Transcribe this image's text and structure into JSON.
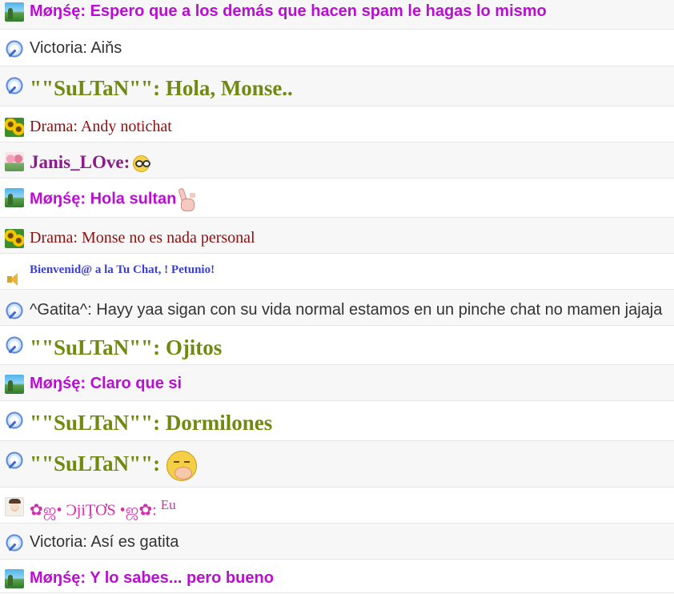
{
  "messages": [
    {
      "name": "Møŋśę",
      "text": "Espero que a los demás que hacen spam le hagas lo mismo",
      "avatar": "landscape-avatar-icon",
      "style": "sans-bold-purple",
      "height": 37,
      "pad_top": 3
    },
    {
      "name": "Victoria",
      "text": "Aiňs",
      "avatar": "feather-avatar-icon",
      "style": "sans-gray",
      "height": 46,
      "pad_top": 12
    },
    {
      "name": "\"\"SuLTaN\"\"",
      "text": "Hola, Monse..",
      "avatar": "feather-avatar-icon",
      "style": "serif-olive",
      "height": 50,
      "pad_top": 12
    },
    {
      "name": "Drama",
      "text": "Andy notichat",
      "avatar": "sunflower-avatar-icon",
      "style": "serif-red",
      "height": 45,
      "pad_top": 14
    },
    {
      "name": "Janis_LOve",
      "text": "",
      "avatar": "tulip-avatar-icon",
      "style": "serif-bold-purple",
      "height": 45,
      "pad_top": 12,
      "emoji": "nerd-emoji-icon"
    },
    {
      "name": "Møŋśę",
      "text": "Hola sultan",
      "avatar": "landscape-avatar-icon",
      "style": "sans-bold-purple",
      "height": 49,
      "pad_top": 12,
      "emoji": "peace-hand-emoji-icon"
    },
    {
      "name": "Drama",
      "text": "Monse no es nada personal",
      "avatar": "sunflower-avatar-icon",
      "style": "serif-red",
      "height": 45,
      "pad_top": 14
    },
    {
      "name": "",
      "text": "Bienvenid@ a la Tu Chat, ! Petunio!",
      "avatar": "speaker-icon",
      "style": "system",
      "height": 45,
      "pad_top": 12
    },
    {
      "name": "^Gatita^",
      "text": "Hayy yaa sigan con su vida normal estamos en un pinche chat no mamen jajaja",
      "avatar": "feather-avatar-icon",
      "style": "sans-gray",
      "height": 45,
      "pad_top": 14
    },
    {
      "name": "\"\"SuLTaN\"\"",
      "text": "Ojitos",
      "avatar": "feather-avatar-icon",
      "style": "serif-olive",
      "height": 49,
      "pad_top": 12
    },
    {
      "name": "Møŋśę",
      "text": "Claro que si",
      "avatar": "landscape-avatar-icon",
      "style": "sans-bold-purple",
      "height": 45,
      "pad_top": 12
    },
    {
      "name": "\"\"SuLTaN\"\"",
      "text": "Dormilones",
      "avatar": "feather-avatar-icon",
      "style": "serif-olive",
      "height": 50,
      "pad_top": 12
    },
    {
      "name": "\"\"SuLTaN\"\"",
      "text": "",
      "avatar": "feather-avatar-icon",
      "style": "serif-olive",
      "height": 58,
      "pad_top": 12,
      "emoji": "yawn-emoji-icon"
    },
    {
      "name": "✿ஜ• ƆjiŢƠS •ஜ✿",
      "text": "Eu",
      "avatar": "face-avatar-icon",
      "style": "pink",
      "height": 45,
      "pad_top": 12
    },
    {
      "name": "Victoria",
      "text": "Así es gatita",
      "avatar": "feather-avatar-icon",
      "style": "sans-gray",
      "height": 45,
      "pad_top": 12
    },
    {
      "name": "Møŋśę",
      "text": "Y lo sabes... pero bueno",
      "avatar": "landscape-avatar-icon",
      "style": "sans-bold-purple",
      "height": 42,
      "pad_top": 12
    }
  ]
}
